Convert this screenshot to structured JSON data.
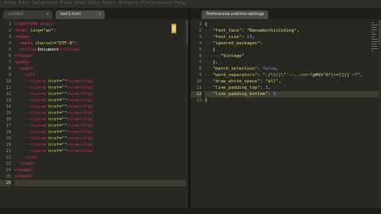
{
  "window": {
    "menu_text": "File  Edit  Selection  Find  View  Goto  Tools  Project  Preferences  Help"
  },
  "left_pane": {
    "tabs": [
      {
        "label": "untitled",
        "active": false
      },
      {
        "label": "test1.html",
        "active": true
      }
    ],
    "line_numbers": [
      "1",
      "2",
      "3",
      "4",
      "5",
      "6",
      "7",
      "8",
      "9",
      "10",
      "11",
      "12",
      "13",
      "14",
      "15",
      "16",
      "17",
      "18",
      "19",
      "20",
      "21",
      "22",
      "23",
      "24",
      "25",
      "26"
    ],
    "lines": [
      [
        [
          "tag",
          "<!DOCTYPE html>"
        ]
      ],
      [
        [
          "tag",
          "<html"
        ],
        [
          "attr",
          " lang"
        ],
        [
          "punc",
          "="
        ],
        [
          "str",
          "\"en\""
        ],
        [
          "tag",
          ">"
        ]
      ],
      [
        [
          "tag",
          "<head>"
        ]
      ],
      [
        [
          "dots",
          "··"
        ],
        [
          "tag",
          "<meta"
        ],
        [
          "attr",
          " charset"
        ],
        [
          "punc",
          "="
        ],
        [
          "str",
          "\"UTF-8\""
        ],
        [
          "tag",
          ">"
        ]
      ],
      [
        [
          "dots",
          "··"
        ],
        [
          "tag",
          "<title>"
        ],
        [
          "punc",
          "Document"
        ],
        [
          "tag",
          "</title>"
        ]
      ],
      [
        [
          "tag",
          "</head>"
        ]
      ],
      [
        [
          "tag",
          "<body>"
        ]
      ],
      [
        [
          "dots",
          "··"
        ],
        [
          "tag",
          "<nav>"
        ]
      ],
      [
        [
          "dots",
          "····"
        ],
        [
          "tag",
          "<ul>"
        ]
      ],
      [
        [
          "dots",
          "······"
        ],
        [
          "tag",
          "<li><a"
        ],
        [
          "attr",
          " href"
        ],
        [
          "punc",
          "="
        ],
        [
          "str",
          "\"\""
        ],
        [
          "tag",
          "></a></li>"
        ]
      ],
      [
        [
          "dots",
          "······"
        ],
        [
          "tag",
          "<li><a"
        ],
        [
          "attr",
          " href"
        ],
        [
          "punc",
          "="
        ],
        [
          "str",
          "\"\""
        ],
        [
          "tag",
          "></a></li>"
        ]
      ],
      [
        [
          "dots",
          "······"
        ],
        [
          "tag",
          "<li><a"
        ],
        [
          "attr",
          " href"
        ],
        [
          "punc",
          "="
        ],
        [
          "str",
          "\"\""
        ],
        [
          "tag",
          "></a></li>"
        ]
      ],
      [
        [
          "dots",
          "······"
        ],
        [
          "tag",
          "<li><a"
        ],
        [
          "attr",
          " href"
        ],
        [
          "punc",
          "="
        ],
        [
          "str",
          "\"\""
        ],
        [
          "tag",
          "></a></li>"
        ]
      ],
      [
        [
          "dots",
          "······"
        ],
        [
          "tag",
          "<li><a"
        ],
        [
          "attr",
          " href"
        ],
        [
          "punc",
          "="
        ],
        [
          "str",
          "\"\""
        ],
        [
          "tag",
          "></a></li>"
        ]
      ],
      [
        [
          "dots",
          "······"
        ],
        [
          "tag",
          "<li><a"
        ],
        [
          "attr",
          " href"
        ],
        [
          "punc",
          "="
        ],
        [
          "str",
          "\"\""
        ],
        [
          "tag",
          "></a></li>"
        ]
      ],
      [
        [
          "dots",
          "······"
        ],
        [
          "tag",
          "<li><a"
        ],
        [
          "attr",
          " href"
        ],
        [
          "punc",
          "="
        ],
        [
          "str",
          "\"\""
        ],
        [
          "tag",
          "></a></li>"
        ]
      ],
      [
        [
          "dots",
          "······"
        ],
        [
          "tag",
          "<li><a"
        ],
        [
          "attr",
          " href"
        ],
        [
          "punc",
          "="
        ],
        [
          "str",
          "\"\""
        ],
        [
          "tag",
          "></a></li>"
        ]
      ],
      [
        [
          "dots",
          "······"
        ],
        [
          "tag",
          "<li><a"
        ],
        [
          "attr",
          " href"
        ],
        [
          "punc",
          "="
        ],
        [
          "str",
          "\"\""
        ],
        [
          "tag",
          "></a></li>"
        ]
      ],
      [
        [
          "dots",
          "······"
        ],
        [
          "tag",
          "<li><a"
        ],
        [
          "attr",
          " href"
        ],
        [
          "punc",
          "="
        ],
        [
          "str",
          "\"\""
        ],
        [
          "tag",
          "></a></li>"
        ]
      ],
      [
        [
          "dots",
          "······"
        ],
        [
          "tag",
          "<li><a"
        ],
        [
          "attr",
          " href"
        ],
        [
          "punc",
          "="
        ],
        [
          "str",
          "\"\""
        ],
        [
          "tag",
          "></a></li>"
        ]
      ],
      [
        [
          "dots",
          "······"
        ],
        [
          "tag",
          "<li><a"
        ],
        [
          "attr",
          " href"
        ],
        [
          "punc",
          "="
        ],
        [
          "str",
          "\"\""
        ],
        [
          "tag",
          "></a></li>"
        ]
      ],
      [
        [
          "dots",
          "····"
        ],
        [
          "tag",
          "</ul>"
        ]
      ],
      [
        [
          "dots",
          "··"
        ],
        [
          "tag",
          "</nav>"
        ]
      ],
      [
        [
          "tag",
          "</body>"
        ]
      ],
      [
        [
          "tag",
          "</html>"
        ]
      ],
      []
    ],
    "highlight_line": 26
  },
  "right_pane": {
    "tabs": [
      {
        "label": "Preferences.sublime-settings",
        "active": true
      }
    ],
    "line_numbers": [
      "1",
      "2",
      "3",
      "4",
      "5",
      "6",
      "7",
      "8",
      "9",
      "10",
      "11",
      "12",
      "13"
    ],
    "lines": [
      [
        [
          "punc",
          "{"
        ]
      ],
      [
        [
          "dots",
          "———"
        ],
        [
          "str",
          "\"font_face\""
        ],
        [
          "punc",
          ": "
        ],
        [
          "str",
          "\"NanumGothicCoding\""
        ],
        [
          "punc",
          ","
        ]
      ],
      [
        [
          "dots",
          "———"
        ],
        [
          "str",
          "\"font_size\""
        ],
        [
          "punc",
          ": "
        ],
        [
          "num",
          "13"
        ],
        [
          "punc",
          ","
        ]
      ],
      [
        [
          "dots",
          "———"
        ],
        [
          "str",
          "\"ignored_packages\""
        ],
        [
          "punc",
          ":"
        ]
      ],
      [
        [
          "dots",
          "———"
        ],
        [
          "punc",
          "["
        ]
      ],
      [
        [
          "dots",
          "——————"
        ],
        [
          "str",
          "\"Vintage\""
        ]
      ],
      [
        [
          "dots",
          "———"
        ],
        [
          "punc",
          "],"
        ]
      ],
      [
        [
          "dots",
          "———"
        ],
        [
          "str",
          "\"match_selection\""
        ],
        [
          "punc",
          ": "
        ],
        [
          "kw",
          "false"
        ],
        [
          "punc",
          ","
        ]
      ],
      [
        [
          "dots",
          "———"
        ],
        [
          "str",
          "\"word_separators\""
        ],
        [
          "punc",
          ": "
        ],
        [
          "str",
          "\"./\\\\()\\\"'-:,.;<>~!@#$%^&*|+=[]{}`~?\""
        ],
        [
          "punc",
          ","
        ]
      ],
      [
        [
          "dots",
          "———"
        ],
        [
          "str",
          "\"draw_white_space\""
        ],
        [
          "punc",
          ": "
        ],
        [
          "str",
          "\"all\""
        ],
        [
          "punc",
          ","
        ]
      ],
      [
        [
          "dots",
          "———"
        ],
        [
          "str",
          "\"line_padding_top\""
        ],
        [
          "punc",
          ": "
        ],
        [
          "num",
          "3"
        ],
        [
          "punc",
          ","
        ]
      ],
      [
        [
          "dots",
          "———"
        ],
        [
          "str",
          "\"line_padding_bottom\""
        ],
        [
          "punc",
          ": "
        ],
        [
          "num",
          "3"
        ]
      ],
      [
        [
          "punc",
          "}"
        ]
      ]
    ],
    "highlight_line": 12
  },
  "colors": {
    "editor_bg": "#272822",
    "tag": "#f92672",
    "attr": "#a6e22e",
    "string": "#e6db74",
    "number": "#ae81ff"
  },
  "icons": [
    "cursor-icon",
    "close-icon"
  ]
}
